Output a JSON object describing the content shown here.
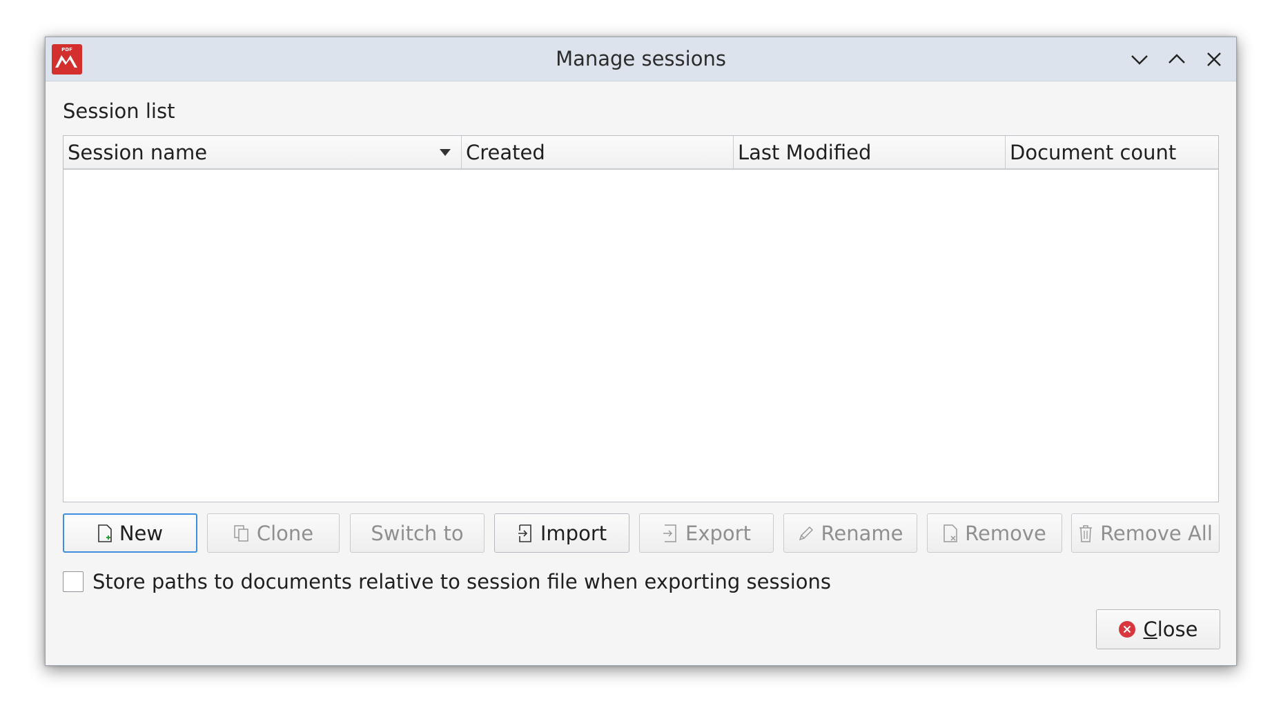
{
  "window": {
    "title": "Manage sessions"
  },
  "session_list": {
    "label": "Session list",
    "columns": [
      "Session name",
      "Created",
      "Last Modified",
      "Document count"
    ],
    "rows": []
  },
  "buttons": {
    "new": "New",
    "clone": "Clone",
    "switch_to": "Switch to",
    "import": "Import",
    "export": "Export",
    "rename": "Rename",
    "remove": "Remove",
    "remove_all": "Remove All",
    "close_mnemonic": "C",
    "close_rest": "lose"
  },
  "options": {
    "relative_paths_label": "Store paths to documents relative to session file when exporting sessions",
    "relative_paths_checked": false
  },
  "colors": {
    "accent": "#3d8ee0",
    "app_icon_red": "#d32f2f",
    "close_icon_red": "#d9363e"
  },
  "icons": {
    "app": "pdf-app-icon",
    "minimize": "chevron-down-icon",
    "maximize": "chevron-up-icon",
    "close": "close-icon",
    "new": "new-document-icon",
    "clone": "clone-icon",
    "import": "import-icon",
    "export": "export-icon",
    "rename": "pencil-icon",
    "remove": "remove-document-icon",
    "remove_all": "trash-icon",
    "close_button": "close-circle-icon"
  }
}
